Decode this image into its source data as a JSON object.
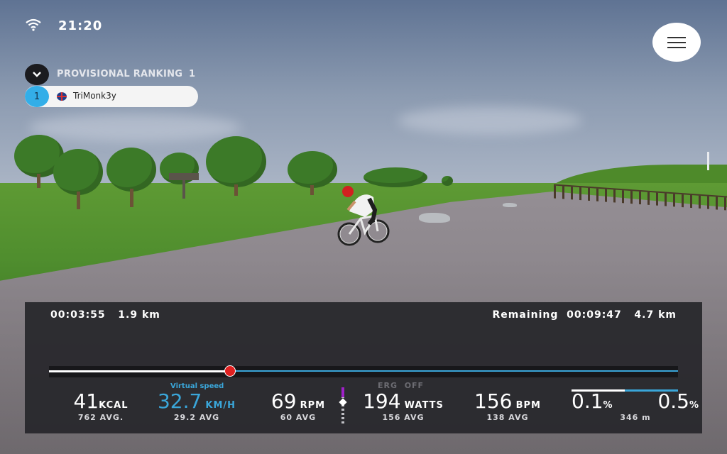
{
  "status_bar": {
    "time": "21:20",
    "wifi_icon": "wifi-icon"
  },
  "menu": {
    "icon": "hamburger-icon"
  },
  "ranking": {
    "title": "PROVISIONAL RANKING",
    "count": "1",
    "entries": [
      {
        "position": "1",
        "flag": "uk-flag-icon",
        "name": "TriMonk3y"
      }
    ]
  },
  "ride": {
    "elapsed_time": "00:03:55",
    "elapsed_distance": "1.9 km",
    "remaining_label": "Remaining",
    "remaining_time": "00:09:47",
    "remaining_distance": "4.7 km",
    "progress_fraction": 0.288
  },
  "metrics": {
    "calories": {
      "value": "41",
      "unit": "KCAL",
      "avg": "762 AVG."
    },
    "speed": {
      "label": "Virtual speed",
      "value": "32.7",
      "unit": "KM/H",
      "avg": "29.2 AVG"
    },
    "cadence": {
      "value": "69",
      "unit": "RPM",
      "avg": "60 AVG"
    },
    "power": {
      "value": "194",
      "unit": "WATTS",
      "avg": "156 AVG",
      "erg_label": "ERG",
      "erg_state": "OFF"
    },
    "heart_rate": {
      "value": "156",
      "unit": "BPM",
      "avg": "138 AVG"
    },
    "grade": {
      "current": "0.1",
      "next": "0.5",
      "unit": "%",
      "distance": "346 m",
      "progress_fraction": 0.5
    }
  },
  "colors": {
    "accent_blue": "#3aa6d9",
    "position_dot": "#e02020",
    "erg_purple": "#a020c8"
  }
}
